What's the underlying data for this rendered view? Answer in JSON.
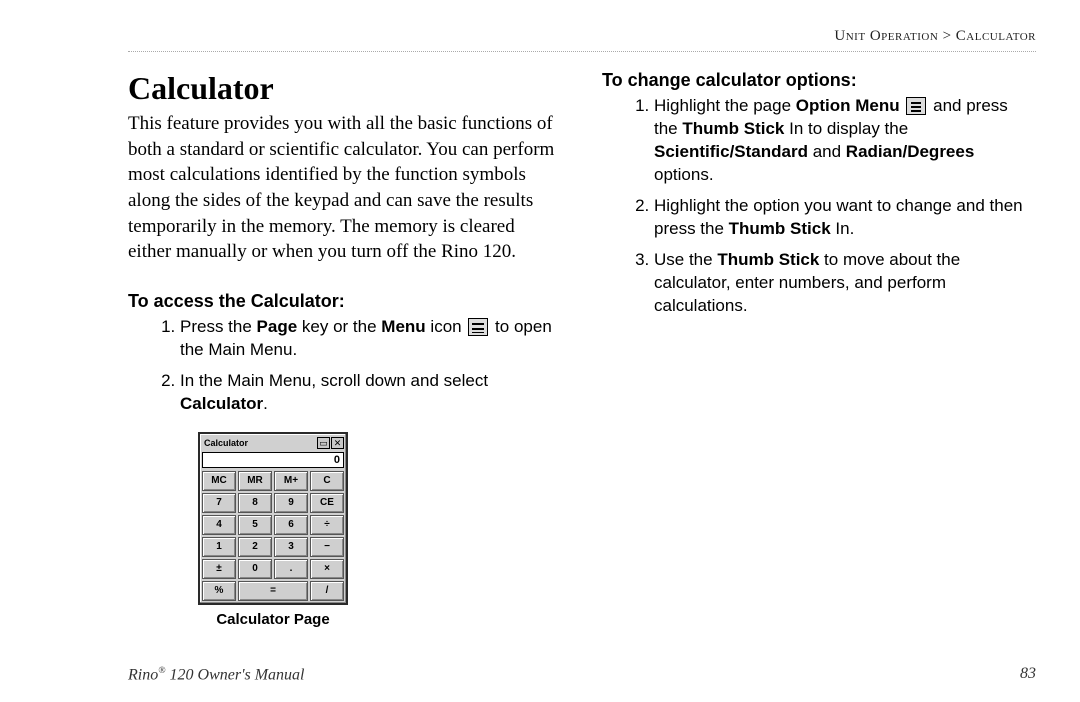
{
  "breadcrumb": {
    "section": "Unit Operation",
    "sep": " > ",
    "page": "Calculator"
  },
  "heading": "Calculator",
  "intro": "This feature provides you with all the basic functions of both a standard or scientific calculator. You can perform most calculations identified by the function symbols along the sides of the keypad and can save the results temporarily in the memory. The memory is cleared either manually or when you turn off the Rino 120.",
  "left": {
    "subhead": "To access the Calculator:",
    "steps": {
      "s1a": "Press the ",
      "s1b": "Page",
      "s1c": " key or the ",
      "s1d": "Menu",
      "s1e": " icon ",
      "s1f": " to open the Main Menu.",
      "s2a": "In the Main Menu, scroll down and select ",
      "s2b": "Calculator",
      "s2c": "."
    },
    "fig_caption": "Calculator Page",
    "calc": {
      "title": "Calculator",
      "sysbtn1": "▭",
      "sysbtn2": "✕",
      "display": "0",
      "keys": [
        "MC",
        "MR",
        "M+",
        "C",
        "7",
        "8",
        "9",
        "CE",
        "4",
        "5",
        "6",
        "÷",
        "1",
        "2",
        "3",
        "−",
        "±",
        "0",
        ".",
        "×",
        "%",
        "=",
        "/",
        ""
      ]
    }
  },
  "right": {
    "subhead": "To change calculator options:",
    "steps": {
      "s1a": "Highlight the page ",
      "s1b": "Option Menu",
      "s1c": " ",
      "s1d": " and press the ",
      "s1e": "Thumb Stick",
      "s1f": " In to display the ",
      "s1g": "Scientific/Standard",
      "s1h": " and ",
      "s1i": "Radian/Degrees",
      "s1j": " options.",
      "s2a": "Highlight the option you want to change and then press the ",
      "s2b": "Thumb Stick",
      "s2c": " In.",
      "s3a": "Use the ",
      "s3b": "Thumb Stick",
      "s3c": " to move about the calculator, enter numbers, and perform calculations."
    }
  },
  "footer": {
    "manual_a": "Rino",
    "manual_b": " 120 Owner's Manual",
    "pagenum": "83"
  }
}
